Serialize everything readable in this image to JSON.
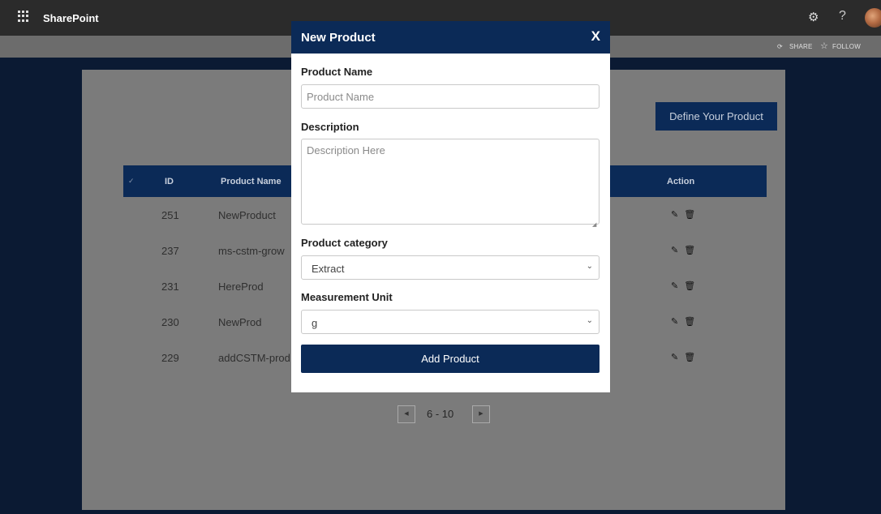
{
  "suitebar": {
    "app_name": "SharePoint",
    "settings_icon": "gear-icon",
    "help_label": "?"
  },
  "commandbar": {
    "share_label": "SHARE",
    "follow_label": "FOLLOW"
  },
  "page": {
    "define_button": "Define Your Product",
    "table": {
      "columns": [
        "ID",
        "Product Name",
        "Action"
      ],
      "rows": [
        {
          "id": "251",
          "name": "NewProduct"
        },
        {
          "id": "237",
          "name": "ms-cstm-grow"
        },
        {
          "id": "231",
          "name": "HereProd"
        },
        {
          "id": "230",
          "name": "NewProd"
        },
        {
          "id": "229",
          "name": "addCSTM-prod"
        }
      ]
    },
    "pager": {
      "range": "6 - 10"
    }
  },
  "modal": {
    "title": "New Product",
    "close": "X",
    "product_name": {
      "label": "Product Name",
      "placeholder": "Product Name",
      "value": ""
    },
    "description": {
      "label": "Description",
      "placeholder": "Description Here",
      "value": ""
    },
    "category": {
      "label": "Product category",
      "selected": "Extract"
    },
    "unit": {
      "label": "Measurement Unit",
      "selected": "g"
    },
    "submit": "Add Product"
  },
  "colors": {
    "brand_navy": "#0b2a57",
    "suitebar": "#2b2b2b"
  }
}
